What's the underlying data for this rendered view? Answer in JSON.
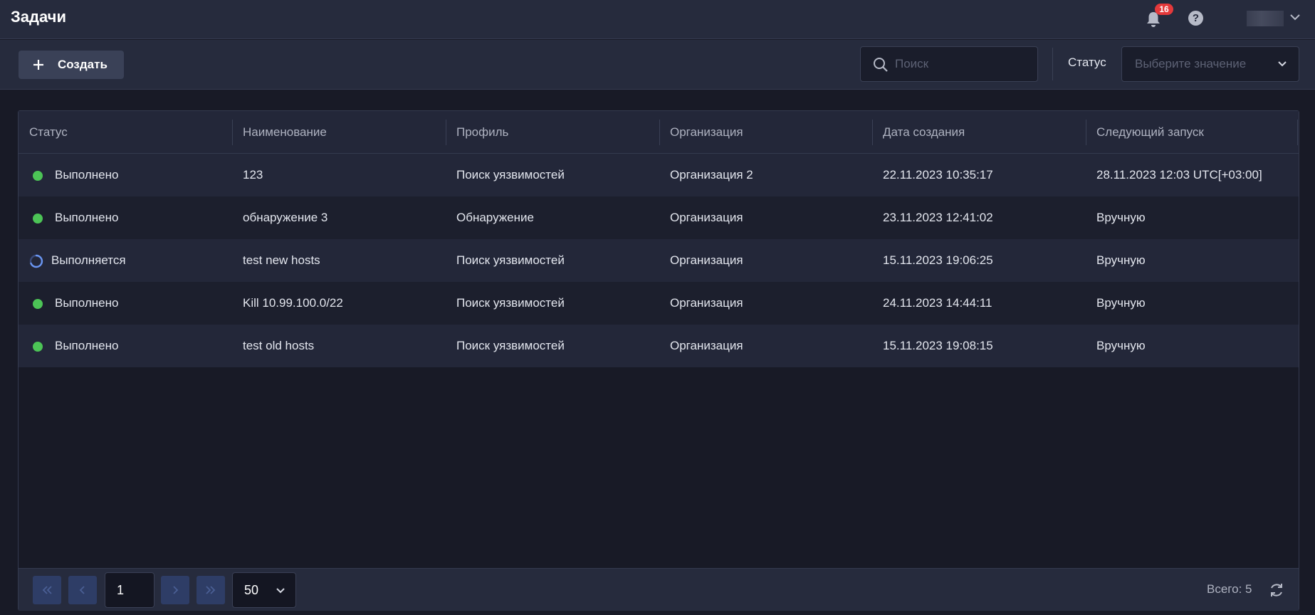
{
  "header": {
    "title": "Задачи",
    "notifications_count": "16",
    "help_symbol": "?"
  },
  "toolbar": {
    "create_label": "Создать",
    "search_placeholder": "Поиск",
    "status_filter_label": "Статус",
    "status_filter_placeholder": "Выберите значение"
  },
  "table": {
    "columns": [
      "Статус",
      "Наименование",
      "Профиль",
      "Организация",
      "Дата создания",
      "Следующий запуск"
    ],
    "rows": [
      {
        "status": "Выполнено",
        "state": "done",
        "name": "123",
        "profile": "Поиск уязвимостей",
        "org": "Организация 2",
        "created": "22.11.2023 10:35:17",
        "next_run": "28.11.2023 12:03 UTC[+03:00]"
      },
      {
        "status": "Выполнено",
        "state": "done",
        "name": "обнаружение 3",
        "profile": "Обнаружение",
        "org": "Организация",
        "created": "23.11.2023 12:41:02",
        "next_run": "Вручную"
      },
      {
        "status": "Выполняется",
        "state": "running",
        "name": "test new hosts",
        "profile": "Поиск уязвимостей",
        "org": "Организация",
        "created": "15.11.2023 19:06:25",
        "next_run": "Вручную"
      },
      {
        "status": "Выполнено",
        "state": "done",
        "name": "Kill 10.99.100.0/22",
        "profile": "Поиск уязвимостей",
        "org": "Организация",
        "created": "24.11.2023 14:44:11",
        "next_run": "Вручную"
      },
      {
        "status": "Выполнено",
        "state": "done",
        "name": "test old hosts",
        "profile": "Поиск уязвимостей",
        "org": "Организация",
        "created": "15.11.2023 19:08:15",
        "next_run": "Вручную"
      }
    ]
  },
  "pagination": {
    "current_page": "1",
    "per_page": "50",
    "total_label": "Всего: 5"
  },
  "colors": {
    "status_done": "#4cc456",
    "status_running": "#5b8cf0",
    "badge": "#e5393b",
    "background": "#181a26",
    "panel": "#262b3d"
  },
  "icons": {
    "notifications": "bell-icon",
    "help": "help-icon",
    "user_menu": "chevron-down-icon",
    "create": "plus-icon",
    "search": "search-icon",
    "refresh": "refresh-icon"
  }
}
